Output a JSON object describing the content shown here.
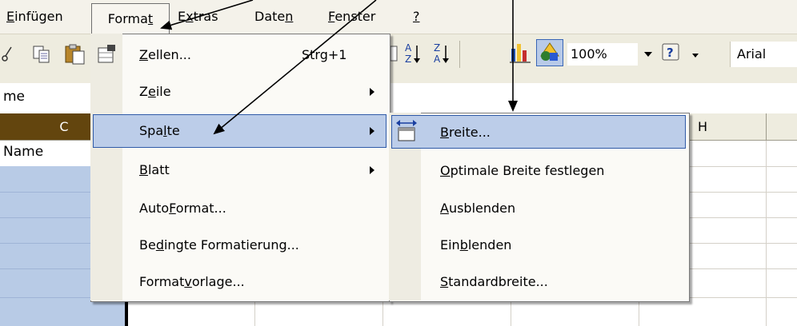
{
  "menubar": {
    "items": [
      "Einfügen",
      "Format",
      "Extras",
      "Daten",
      "Fenster",
      "?"
    ]
  },
  "toolbar": {
    "zoom_value": "100%",
    "font_name": "Arial"
  },
  "namebar": {
    "cell_text": "me"
  },
  "sheet": {
    "col_c": "C",
    "col_h": "H",
    "cell_c1": "Name"
  },
  "format_menu": {
    "items": [
      {
        "label": "Zellen...",
        "shortcut": "Strg+1"
      },
      {
        "label": "Zeile"
      },
      {
        "label": "Spalte"
      },
      {
        "label": "Blatt"
      },
      {
        "label": "AutoFormat..."
      },
      {
        "label": "Bedingte Formatierung..."
      },
      {
        "label": "Formatvorlage..."
      }
    ]
  },
  "spalte_submenu": {
    "items": [
      "Breite...",
      "Optimale Breite festlegen",
      "Ausblenden",
      "Einblenden",
      "Standardbreite..."
    ]
  },
  "colors": {
    "menu_highlight": "#bccde9",
    "menu_highlight_border": "#2f5aa8",
    "selected_column_header": "#63450e",
    "selected_cells": "#b8cbe6"
  },
  "icons": [
    "cut-icon",
    "copy-icon",
    "paste-icon",
    "format-cells-icon",
    "sort-ascending-icon",
    "sort-descending-icon",
    "chart-wizard-icon",
    "drawing-icon",
    "help-icon",
    "column-width-icon"
  ]
}
